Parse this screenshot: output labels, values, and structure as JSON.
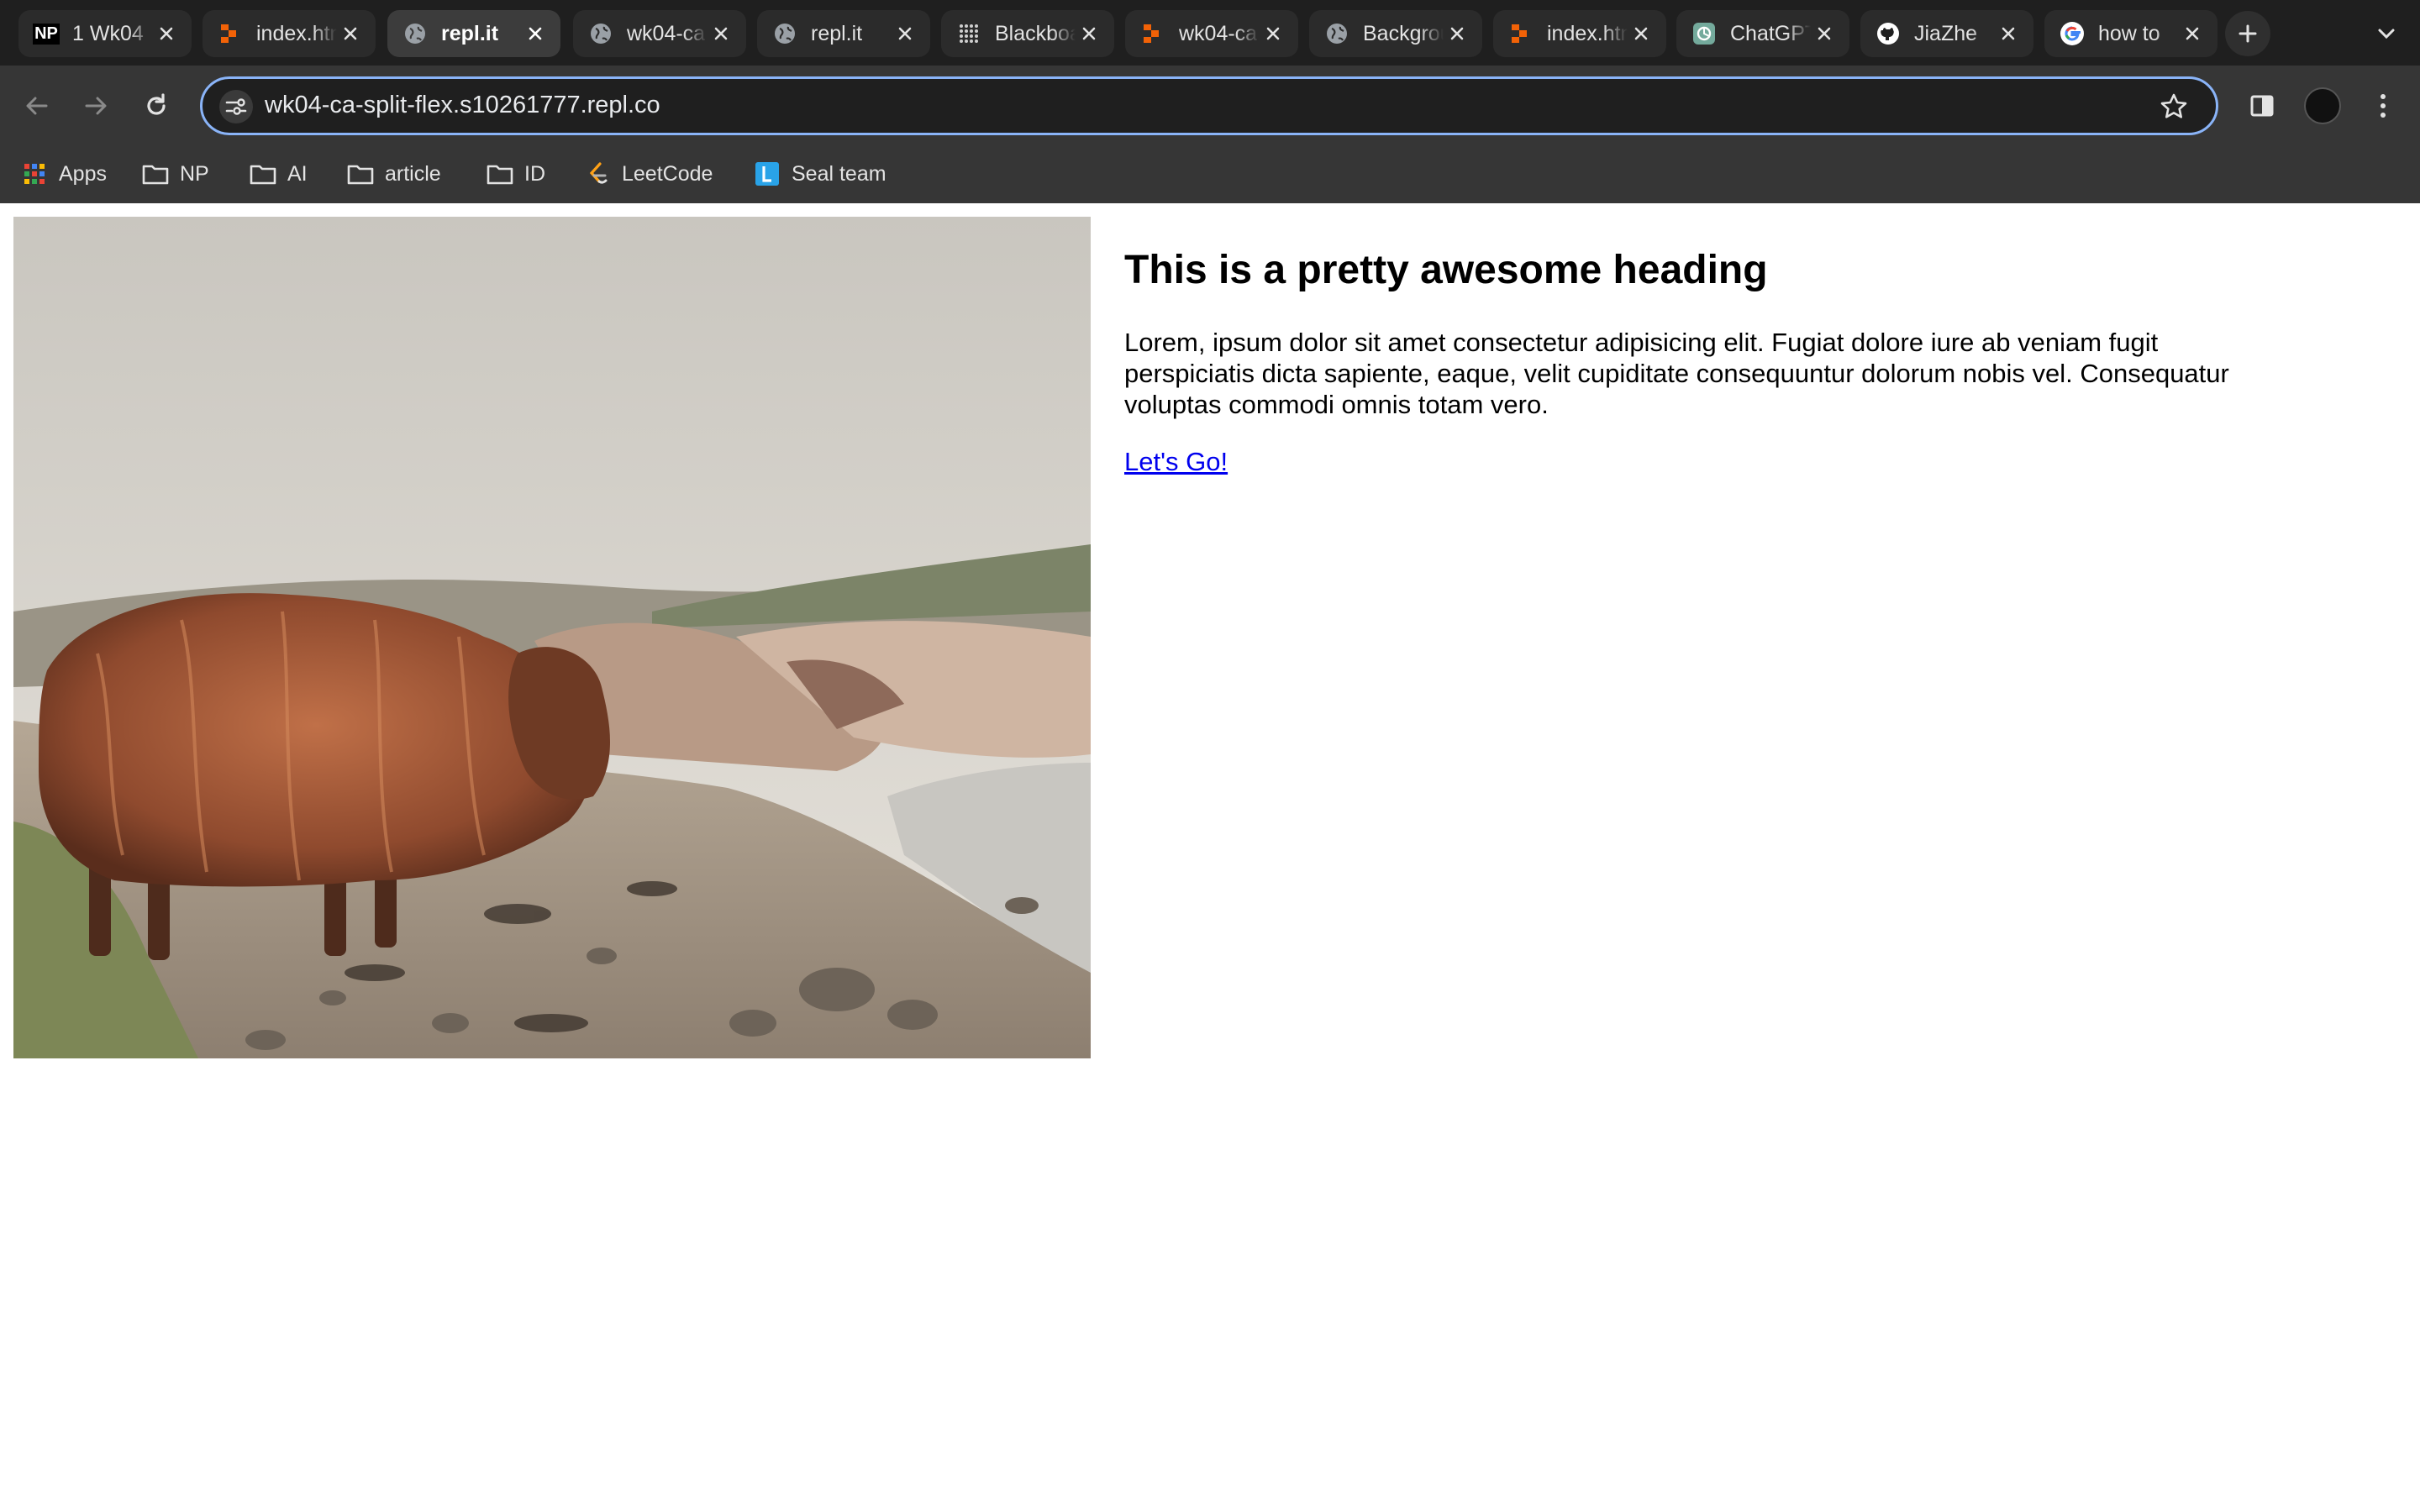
{
  "browser": {
    "tabs": [
      {
        "title": "1 Wk04",
        "favicon": "np-favicon"
      },
      {
        "title": "index.html",
        "favicon": "replit-favicon"
      },
      {
        "title": "repl.it",
        "favicon": "globe-favicon"
      },
      {
        "title": "wk04-ca",
        "favicon": "globe-favicon"
      },
      {
        "title": "repl.it",
        "favicon": "globe-favicon"
      },
      {
        "title": "Blackboard",
        "favicon": "blackboard-favicon"
      },
      {
        "title": "wk04-ca",
        "favicon": "replit-favicon"
      },
      {
        "title": "Background",
        "favicon": "globe-favicon"
      },
      {
        "title": "index.html",
        "favicon": "replit-favicon"
      },
      {
        "title": "ChatGPT",
        "favicon": "chatgpt-favicon"
      },
      {
        "title": "JiaZhe",
        "favicon": "github-favicon"
      },
      {
        "title": "how to",
        "favicon": "google-favicon"
      }
    ],
    "active_tab_index": 2,
    "np_badge": "NP",
    "address": "wk04-ca-split-flex.s10261777.repl.co",
    "bookmarks": [
      {
        "label": "Apps",
        "icon": "apps-grid-icon"
      },
      {
        "label": "NP",
        "icon": "folder-icon"
      },
      {
        "label": "AI",
        "icon": "folder-icon"
      },
      {
        "label": "article",
        "icon": "folder-icon"
      },
      {
        "label": "ID",
        "icon": "folder-icon"
      },
      {
        "label": "LeetCode",
        "icon": "leetcode-icon"
      },
      {
        "label": "Seal team",
        "icon": "seal-team-icon"
      }
    ],
    "colors": {
      "accent": "#8ab4f8",
      "chrome_dark": "#1f1f1f",
      "toolbar": "#363636"
    }
  },
  "page": {
    "image_alt": "Highland cow on a rocky beach",
    "heading": "This is a pretty awesome heading",
    "paragraph": "Lorem, ipsum dolor sit amet consectetur adipisicing elit. Fugiat dolore iure ab veniam fugit perspiciatis dicta sapiente, eaque, velit cupiditate consequuntur dolorum nobis vel. Consequatur voluptas commodi omnis totam vero.",
    "link_text": "Let's Go!",
    "link_color": "#0000ee"
  }
}
